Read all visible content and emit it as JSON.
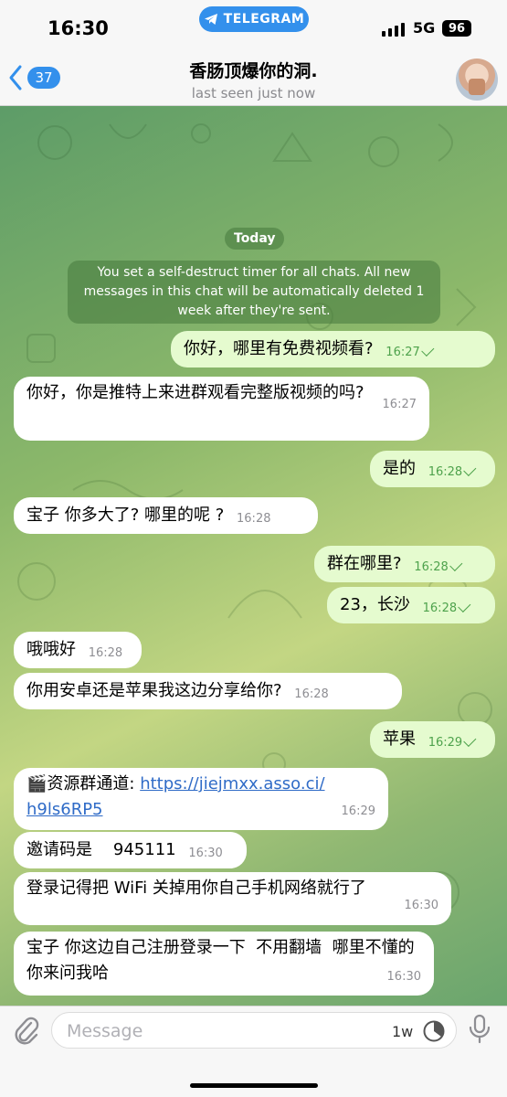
{
  "status_bar": {
    "time": "16:30",
    "app_pill": "TELEGRAM",
    "network": "5G",
    "battery": "96"
  },
  "header": {
    "back_count": "37",
    "title": "香肠顶爆你的洞.",
    "subtitle": "last seen just now"
  },
  "chat": {
    "date_label": "Today",
    "service_message": "You set a self-destruct timer for all chats. All new messages in this chat will be automatically deleted 1 week after they're sent.",
    "messages": [
      {
        "dir": "out",
        "text": "你好，哪里有免费视频看?",
        "time": "16:27"
      },
      {
        "dir": "in",
        "text": "你好，你是推特上来进群观看完整版视频的吗?",
        "time": "16:27"
      },
      {
        "dir": "out",
        "text": "是的",
        "time": "16:28"
      },
      {
        "dir": "in",
        "text": "宝子 你多大了?  哪里的呢 ?",
        "time": "16:28"
      },
      {
        "dir": "out",
        "text": "群在哪里?",
        "time": "16:28"
      },
      {
        "dir": "out",
        "text": "23，长沙",
        "time": "16:28"
      },
      {
        "dir": "in",
        "text": "哦哦好",
        "time": "16:28"
      },
      {
        "dir": "in",
        "text": "你用安卓还是苹果我这边分享给你?",
        "time": "16:28"
      },
      {
        "dir": "out",
        "text": "苹果",
        "time": "16:29"
      },
      {
        "dir": "in",
        "text_prefix": "🎬资源群通道: ",
        "link": "https://jiejmxx.asso.ci/h9ls6RP5",
        "link_line1": "https://jiejmxx.asso.ci/",
        "link_line2": "h9ls6RP5",
        "time": "16:29"
      },
      {
        "dir": "in",
        "text": "邀请码是    945111",
        "time": "16:30"
      },
      {
        "dir": "in",
        "text": "登录记得把 WiFi 关掉用你自己手机网络就行了",
        "time": "16:30"
      },
      {
        "dir": "in",
        "text": "宝子 你这边自己注册登录一下  不用翻墙  哪里不懂的你来问我哈",
        "time": "16:30"
      }
    ]
  },
  "input_bar": {
    "placeholder": "Message",
    "timer_label": "1w"
  },
  "icons": [
    "telegram-icon",
    "back-chevron-icon",
    "paperclip-icon",
    "timer-icon",
    "microphone-icon"
  ],
  "colors": {
    "accent": "#3390ec",
    "outgoing_bubble": "#e5fbcf",
    "incoming_bubble": "#ffffff",
    "read_check": "#4ea24c"
  }
}
